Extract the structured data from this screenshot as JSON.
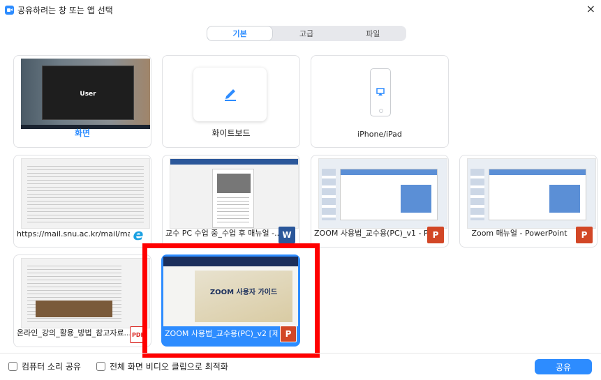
{
  "window": {
    "title": "공유하려는 창 또는 앱 선택",
    "close_label": "×"
  },
  "tabs": [
    {
      "label": "기본",
      "active": true
    },
    {
      "label": "고급",
      "active": false
    },
    {
      "label": "파일",
      "active": false
    }
  ],
  "tiles_row1": [
    {
      "label": "화면",
      "thumb_text": "User",
      "highlighted_label": true
    },
    {
      "label": "화이트보드",
      "icon": "pencil-icon"
    },
    {
      "label": "iPhone/iPad",
      "icon": "airplay-icon"
    }
  ],
  "windows": [
    {
      "label": "https://mail.snu.ac.kr/mail/main...",
      "app_icon": "ie-icon",
      "badge": "e"
    },
    {
      "label": "교수 PC 수업 중_수업 후 매뉴얼 -...",
      "app_icon": "word-icon",
      "badge": "W"
    },
    {
      "label": "ZOOM 사용법_교수용(PC)_v1 - P...",
      "app_icon": "powerpoint-icon",
      "badge": "P"
    },
    {
      "label": "Zoom 매뉴얼 - PowerPoint",
      "app_icon": "powerpoint-icon",
      "badge": "P"
    },
    {
      "label": "온라인_강의_활용_방법_참고자료...",
      "app_icon": "pdf-icon",
      "badge": "PDF"
    },
    {
      "label": "ZOOM 사용법_교수용(PC)_v2 [제...",
      "app_icon": "powerpoint-icon",
      "badge": "P",
      "selected": true,
      "thumb_text": "ZOOM 사용자 가이드"
    }
  ],
  "options": [
    {
      "label": "컴퓨터 소리 공유",
      "checked": false
    },
    {
      "label": "전체 화면 비디오 클립으로 최적화",
      "checked": false
    }
  ],
  "share_button": {
    "label": "공유"
  },
  "colors": {
    "accent": "#2d8cff",
    "selection_outline": "#ff0000"
  }
}
